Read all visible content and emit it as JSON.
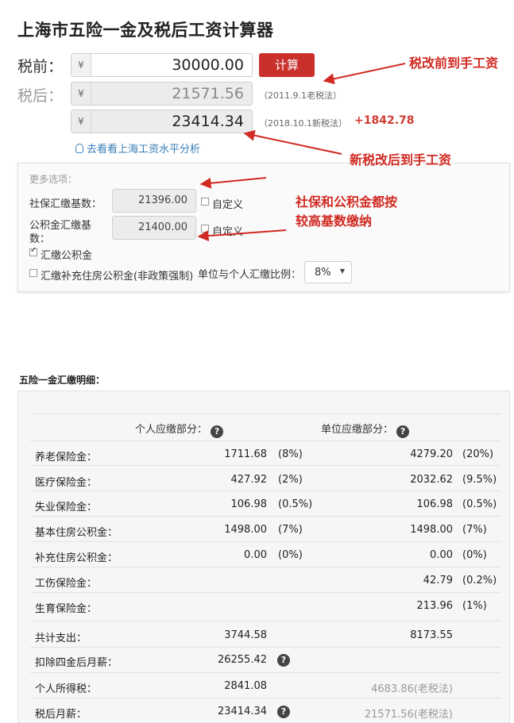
{
  "page": {
    "title": "上海市五险一金及税后工资计算器"
  },
  "calc": {
    "pre_tax_label": "税前：",
    "post_tax_label": "税后：",
    "currency": "¥",
    "pre_tax_value": "30000.00",
    "post_tax_old_value": "21571.56",
    "post_tax_new_value": "23414.34",
    "calc_button": "计算",
    "old_law_note": "（2011.9.1老税法）",
    "new_law_note": "（2018.10.1新税法）",
    "difference": "+1842.78",
    "salary_link": "去看看上海工资水平分析"
  },
  "annotations": {
    "a1": "税改前到手工资",
    "a2": "新税改后到手工资",
    "a3_line1": "社保和公积金都按",
    "a3_line2": "较高基数缴纳"
  },
  "options": {
    "title": "更多选项：",
    "social_base_label": "社保汇缴基数：",
    "social_base_value": "21396.00",
    "fund_base_label_1": "公积金汇缴基",
    "fund_base_label_2": "数：",
    "fund_base_value": "21400.00",
    "custom_label": "自定义",
    "pay_fund_label": "汇缴公积金",
    "pay_fund_checked": true,
    "supp_fund_label": "汇缴补充住房公积金(非政策强制)",
    "ratio_label": "单位与个人汇缴比例：",
    "ratio_value": "8%"
  },
  "details": {
    "title": "五险一金汇缴明细：",
    "personal_header": "个人应缴部分：",
    "company_header": "单位应缴部分：",
    "help_glyph": "?",
    "rows": [
      {
        "label": "养老保险金：",
        "p": "1711.68",
        "pr": "(8%)",
        "c": "4279.20",
        "cr": "(20%)"
      },
      {
        "label": "医疗保险金：",
        "p": "427.92",
        "pr": "(2%)",
        "c": "2032.62",
        "cr": "(9.5%)"
      },
      {
        "label": "失业保险金：",
        "p": "106.98",
        "pr": "(0.5%)",
        "c": "106.98",
        "cr": "(0.5%)"
      },
      {
        "label": "基本住房公积金：",
        "p": "1498.00",
        "pr": "(7%)",
        "c": "1498.00",
        "cr": "(7%)"
      },
      {
        "label": "补充住房公积金：",
        "p": "0.00",
        "pr": "(0%)",
        "c": "0.00",
        "cr": "(0%)"
      },
      {
        "label": "工伤保险金：",
        "p": "",
        "pr": "",
        "c": "42.79",
        "cr": "(0.2%)"
      },
      {
        "label": "生育保险金：",
        "p": "",
        "pr": "",
        "c": "213.96",
        "cr": "(1%)"
      }
    ],
    "total_label": "共计支出：",
    "total_personal": "3744.58",
    "total_company": "8173.55",
    "after_deduct_label": "扣除四金后月薪：",
    "after_deduct_value": "26255.42",
    "income_tax_label": "个人所得税：",
    "income_tax_value": "2841.08",
    "income_tax_old": "4683.86(老税法)",
    "net_label": "税后月薪：",
    "net_value": "23414.34",
    "net_old": "21571.56(老税法)"
  }
}
